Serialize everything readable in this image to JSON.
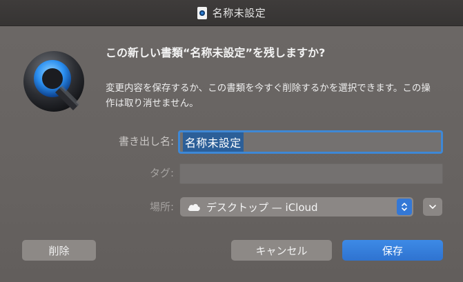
{
  "window": {
    "title": "名称未設定",
    "title_icon": "quicktime-document-icon"
  },
  "dialog": {
    "app_icon": "quicktime-player-icon",
    "headline": "この新しい書類“名称未設定”を残しますか?",
    "message": "変更内容を保存するか、この書類を今すぐ削除するかを選択できます。この操作は取り消せません。",
    "export_label": "書き出し名:",
    "export_value": "名称未設定",
    "tags_label": "タグ:",
    "tags_value": "",
    "where_label": "場所:",
    "where_icon": "cloud-icon",
    "where_value": "デスクトップ — iCloud",
    "delete_label": "削除",
    "cancel_label": "キャンセル",
    "save_label": "保存"
  },
  "colors": {
    "accent": "#3478d6",
    "focus_ring": "#3e88d6",
    "background": "#676361"
  }
}
